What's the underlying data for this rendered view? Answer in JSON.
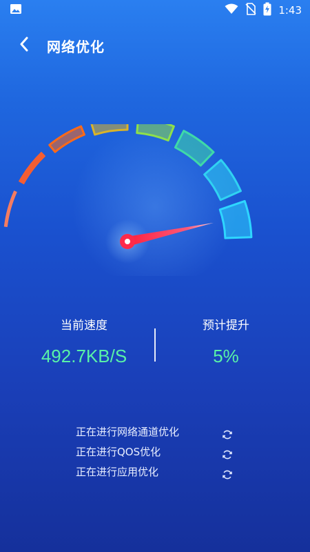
{
  "status_bar": {
    "time": "1:43",
    "icons": [
      "image-icon",
      "wifi-icon",
      "no-sim-icon",
      "battery-charging-icon"
    ]
  },
  "header": {
    "title": "网络优化",
    "back_icon": "chevron-left-icon"
  },
  "gauge": {
    "level": 0.94,
    "colors": {
      "segments": [
        "#ff7e5c",
        "#ff5e2a",
        "#ff6a18",
        "#d9b32a",
        "#8fe04a",
        "#3fd9a8",
        "#30d2f2",
        "#2ed6ff"
      ],
      "needle": "#ff2a4a"
    }
  },
  "stats": {
    "current_speed": {
      "label": "当前速度",
      "value": "492.7KB/S"
    },
    "estimated_boost": {
      "label": "预计提升",
      "value": "5%"
    },
    "value_color": "#59f2a7"
  },
  "tasks": [
    {
      "label": "正在进行网络通道优化",
      "icon": "refresh-icon"
    },
    {
      "label": "正在进行QOS优化",
      "icon": "refresh-icon"
    },
    {
      "label": "正在进行应用优化",
      "icon": "refresh-icon"
    }
  ]
}
